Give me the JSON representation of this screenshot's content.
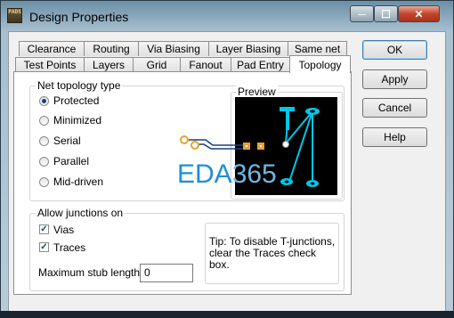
{
  "window": {
    "title": "Design Properties",
    "icon_name": "pads-logo-icon",
    "icon_text": "PADS",
    "caption_buttons": [
      "minimize-icon",
      "maximize-icon",
      "close-icon"
    ]
  },
  "tabs": {
    "row_back": [
      "Clearance",
      "Routing",
      "Via Biasing",
      "Layer Biasing",
      "Same net"
    ],
    "row_front": [
      "Test Points",
      "Layers",
      "Grid",
      "Fanout",
      "Pad Entry",
      "Topology"
    ],
    "active": "Topology"
  },
  "topology": {
    "group_label": "Net topology type",
    "options": [
      "Protected",
      "Minimized",
      "Serial",
      "Parallel",
      "Mid-driven"
    ],
    "selected": "Protected",
    "preview_label": "Preview"
  },
  "junctions": {
    "group_label": "Allow junctions on",
    "vias_label": "Vias",
    "vias_checked": true,
    "traces_label": "Traces",
    "traces_checked": true,
    "stub_label": "Maximum stub length:",
    "stub_value": "0",
    "tip": "Tip: To disable T-junctions, clear the Traces check box."
  },
  "buttons": {
    "ok": "OK",
    "apply": "Apply",
    "cancel": "Cancel",
    "help": "Help"
  },
  "watermark": {
    "letters": "EDA",
    "digits": "365"
  },
  "colors": {
    "preview_bg": "#000000",
    "preview_trace": "#00c8e6",
    "pin_orange": "#e8a030"
  }
}
